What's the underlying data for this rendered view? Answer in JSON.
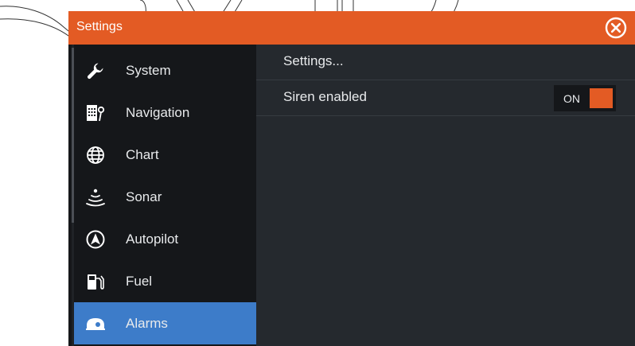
{
  "window": {
    "title": "Settings",
    "close_icon": "close-circle-icon"
  },
  "colors": {
    "titlebar": "#e35b24",
    "accent_active": "#3d7cc9",
    "sidebar_bg": "#15171a",
    "content_bg": "#25292e",
    "toggle_knob": "#e35b24"
  },
  "sidebar": {
    "items": [
      {
        "label": "System",
        "icon": "wrench-icon",
        "active": false
      },
      {
        "label": "Navigation",
        "icon": "navigation-icon",
        "active": false
      },
      {
        "label": "Chart",
        "icon": "globe-icon",
        "active": false
      },
      {
        "label": "Sonar",
        "icon": "sonar-icon",
        "active": false
      },
      {
        "label": "Autopilot",
        "icon": "autopilot-icon",
        "active": false
      },
      {
        "label": "Fuel",
        "icon": "fuel-pump-icon",
        "active": false
      },
      {
        "label": "Alarms",
        "icon": "alarm-icon",
        "active": true
      }
    ]
  },
  "main": {
    "rows": [
      {
        "label": "Settings..."
      },
      {
        "label": "Siren enabled",
        "toggle_label": "ON",
        "toggle_on": true
      }
    ]
  }
}
